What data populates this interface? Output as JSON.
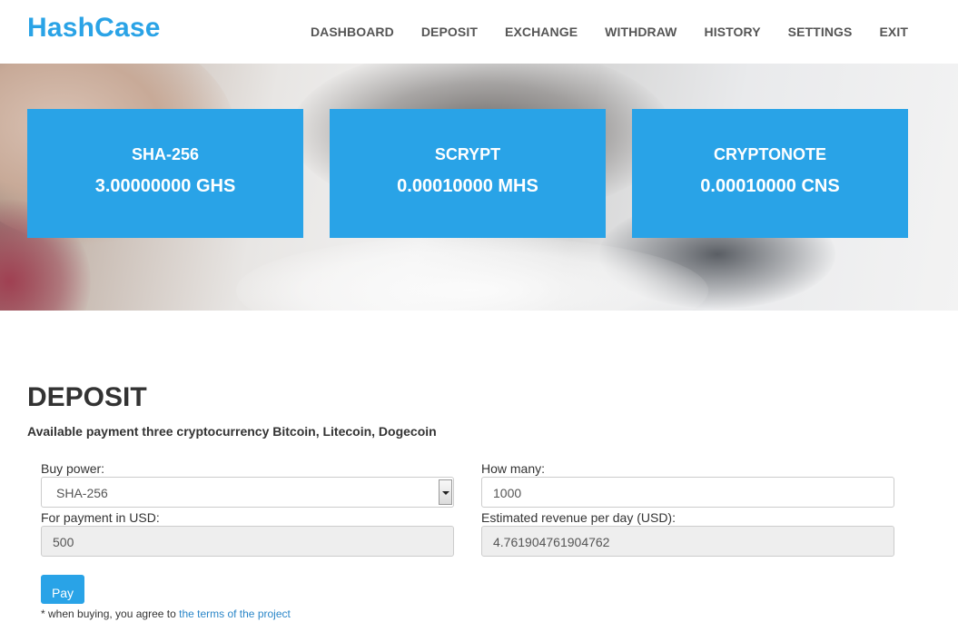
{
  "brand": {
    "logo": "HashCase",
    "accent": "#29a3e7"
  },
  "nav": {
    "items": [
      "DASHBOARD",
      "DEPOSIT",
      "EXCHANGE",
      "WITHDRAW",
      "HISTORY",
      "SETTINGS",
      "EXIT"
    ]
  },
  "cards": [
    {
      "name": "SHA-256",
      "value": "3.00000000 GHS"
    },
    {
      "name": "SCRYPT",
      "value": "0.00010000 MHS"
    },
    {
      "name": "CRYPTONOTE",
      "value": "0.00010000 CNS"
    }
  ],
  "deposit": {
    "title": "DEPOSIT",
    "subtitle": "Available payment three cryptocurrency Bitcoin, Litecoin, Dogecoin",
    "buy_power": {
      "label": "Buy power:",
      "value": "SHA-256"
    },
    "how_many": {
      "label": "How many:",
      "value": "1000"
    },
    "payment_usd": {
      "label": "For payment in USD:",
      "value": "500"
    },
    "revenue": {
      "label": "Estimated revenue per day (USD):",
      "value": "4.761904761904762"
    },
    "pay_label": "Pay",
    "note_prefix": "* when buying, you agree to ",
    "note_link": "the terms of the project"
  }
}
